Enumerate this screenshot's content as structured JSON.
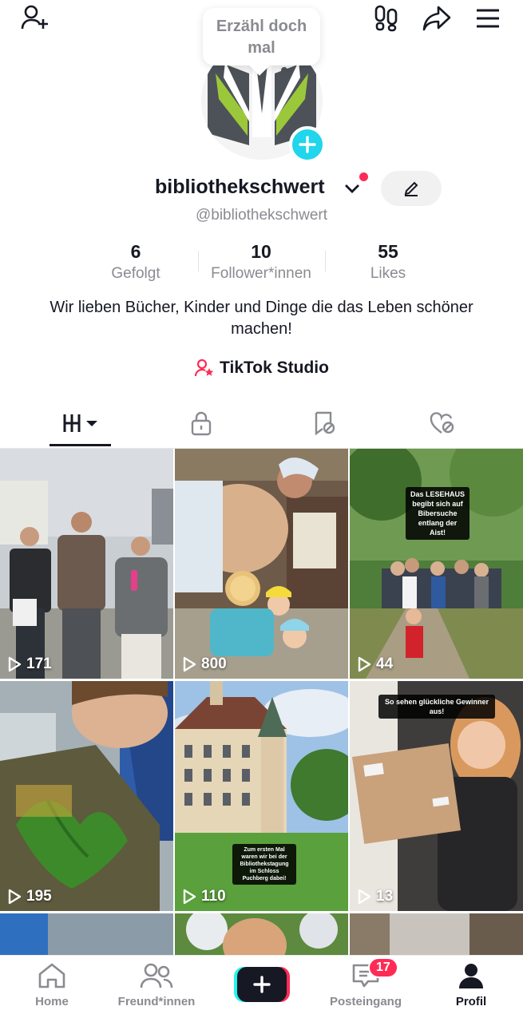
{
  "header": {
    "tooltip": "Erzähl doch mal",
    "icons": [
      "add-friend-icon",
      "footprints-icon",
      "share-icon",
      "menu-icon"
    ]
  },
  "profile": {
    "username": "bibliothekschwert",
    "handle": "@bibliothekschwert",
    "bio": "Wir lieben Bücher, Kinder und Dinge die das Leben schöner machen!",
    "studio_label": "TikTok Studio",
    "stats": [
      {
        "value": "6",
        "label": "Gefolgt"
      },
      {
        "value": "10",
        "label": "Follower*innen"
      },
      {
        "value": "55",
        "label": "Likes"
      }
    ]
  },
  "tabs": [
    "videos-grid-icon",
    "lock-icon",
    "tagged-icon",
    "liked-icon"
  ],
  "videos": [
    {
      "views": "171",
      "overlay": ""
    },
    {
      "views": "800",
      "overlay": ""
    },
    {
      "views": "44",
      "overlay": "Das LESEHAUS begibt sich auf Bibersuche entlang der Aist!"
    },
    {
      "views": "195",
      "overlay": ""
    },
    {
      "views": "110",
      "overlay": "Zum ersten Mal waren wir bei der Bibliothekstagung im Schloss Puchberg dabei!"
    },
    {
      "views": "13",
      "overlay": "So sehen glückliche Gewinner aus!"
    }
  ],
  "bottom_nav": {
    "home": "Home",
    "friends": "Freund*innen",
    "inbox": "Posteingang",
    "inbox_badge": "17",
    "profile": "Profil"
  },
  "colors": {
    "accent": "#fe2c55",
    "cyan": "#20d5ec",
    "text": "#161823",
    "muted": "#8a8b91"
  }
}
